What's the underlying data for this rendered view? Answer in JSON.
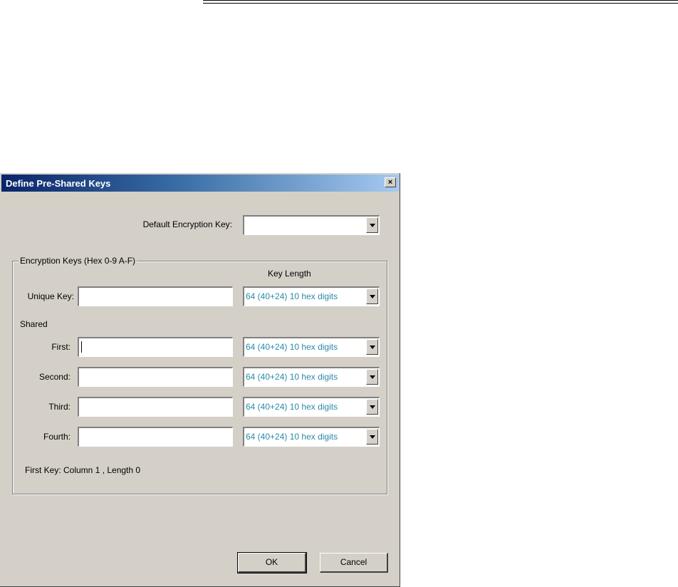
{
  "dialog": {
    "title": "Define Pre-Shared Keys",
    "close_glyph": "×",
    "default_key_label": "Default Encryption Key:",
    "default_key_value": "",
    "group_label": "Encryption Keys (Hex 0-9 A-F)",
    "key_length_header": "Key Length",
    "unique_key_label": "Unique Key:",
    "unique_key_value": "",
    "unique_key_length": "64  (40+24)  10 hex digits",
    "shared_label": "Shared",
    "shared": [
      {
        "label": "First:",
        "value": "",
        "length": "64  (40+24)  10 hex digits"
      },
      {
        "label": "Second:",
        "value": "",
        "length": "64  (40+24)  10 hex digits"
      },
      {
        "label": "Third:",
        "value": "",
        "length": "64  (40+24)  10 hex digits"
      },
      {
        "label": "Fourth:",
        "value": "",
        "length": "64  (40+24)  10 hex digits"
      }
    ],
    "status_text": "First Key: Column 1 ,  Length 0",
    "ok_label": "OK",
    "cancel_label": "Cancel"
  },
  "icons": {
    "close": "close-icon",
    "dropdown": "chevron-down-icon"
  }
}
